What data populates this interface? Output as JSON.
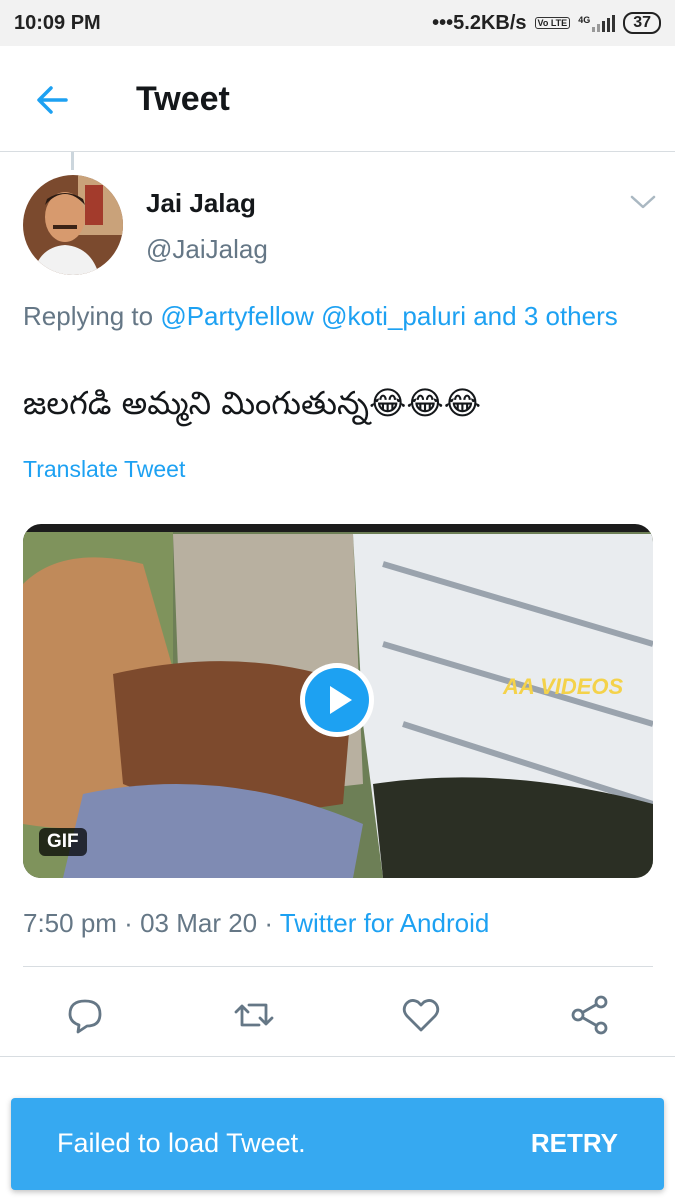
{
  "status_bar": {
    "time": "10:09 PM",
    "network_speed": "•••5.2KB/s",
    "volte": "Vo LTE",
    "signal": "4G",
    "battery": "37"
  },
  "header": {
    "title": "Tweet",
    "back_icon": "arrow-left-icon"
  },
  "tweet": {
    "author_name": "Jai Jalag",
    "author_handle": "@JaiJalag",
    "replying_prefix": "Replying to ",
    "replying_mentions": "@Partyfellow @koti_paluri and 3 others",
    "text": "జలగడి అమ్మని మింగుతున్న😂😂😂",
    "translate_label": "Translate Tweet",
    "media": {
      "badge": "GIF",
      "watermark": "AA VIDEOS"
    },
    "time": "7:50 pm",
    "date": "03 Mar 20",
    "source": "Twitter for Android",
    "meta_separator": " · "
  },
  "actions": [
    "reply-icon",
    "retweet-icon",
    "like-icon",
    "share-icon"
  ],
  "toast": {
    "message": "Failed to load Tweet.",
    "action": "RETRY"
  },
  "colors": {
    "accent": "#1da1f2",
    "secondary_text": "#657786",
    "toast_bg": "#36a9f1"
  }
}
